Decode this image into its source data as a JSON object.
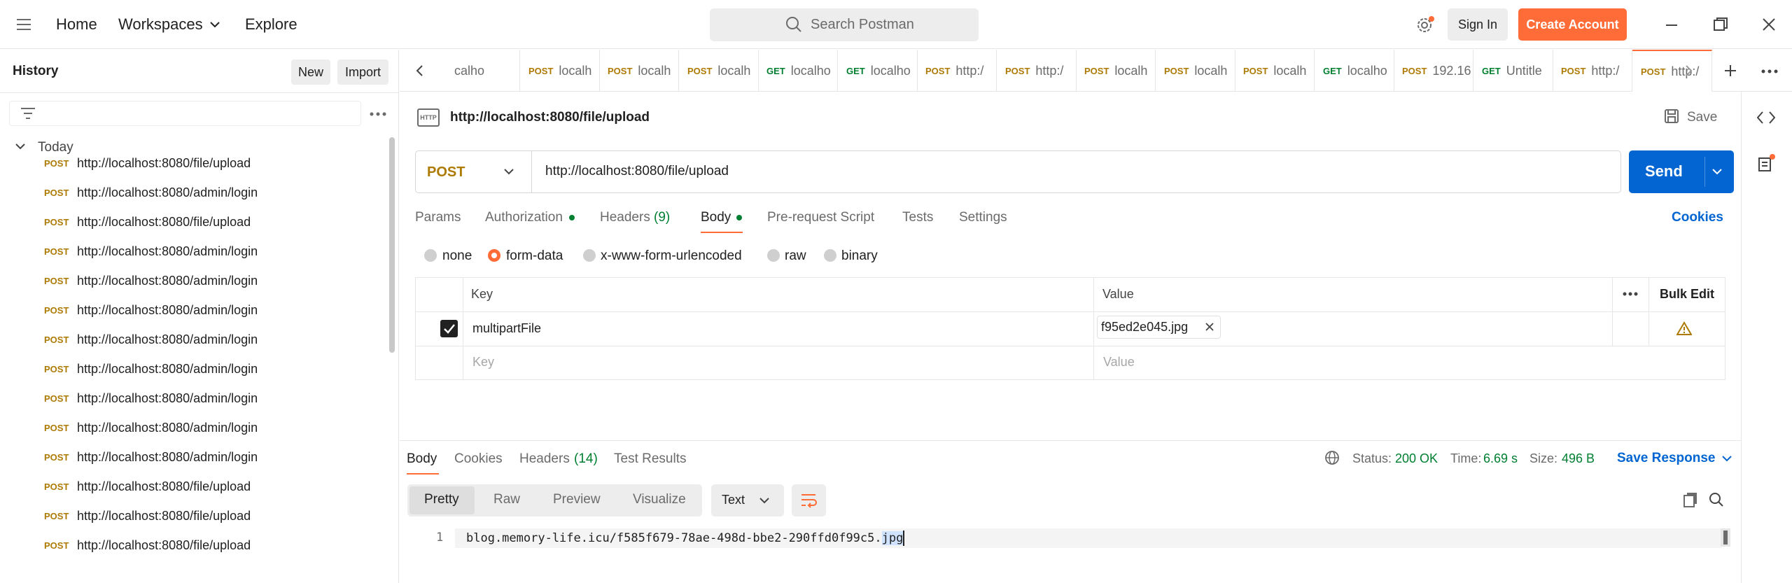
{
  "topbar": {
    "home": "Home",
    "workspaces": "Workspaces",
    "explore": "Explore",
    "search_placeholder": "Search Postman",
    "sign_in": "Sign In",
    "create_account": "Create Account"
  },
  "sidebar": {
    "title": "History",
    "new_button": "New",
    "import_button": "Import",
    "group": "Today",
    "items": [
      {
        "method": "POST",
        "url": "http://localhost:8080/file/upload"
      },
      {
        "method": "POST",
        "url": "http://localhost:8080/admin/login"
      },
      {
        "method": "POST",
        "url": "http://localhost:8080/file/upload"
      },
      {
        "method": "POST",
        "url": "http://localhost:8080/admin/login"
      },
      {
        "method": "POST",
        "url": "http://localhost:8080/admin/login"
      },
      {
        "method": "POST",
        "url": "http://localhost:8080/admin/login"
      },
      {
        "method": "POST",
        "url": "http://localhost:8080/admin/login"
      },
      {
        "method": "POST",
        "url": "http://localhost:8080/admin/login"
      },
      {
        "method": "POST",
        "url": "http://localhost:8080/admin/login"
      },
      {
        "method": "POST",
        "url": "http://localhost:8080/admin/login"
      },
      {
        "method": "POST",
        "url": "http://localhost:8080/admin/login"
      },
      {
        "method": "POST",
        "url": "http://localhost:8080/file/upload"
      },
      {
        "method": "POST",
        "url": "http://localhost:8080/file/upload"
      },
      {
        "method": "POST",
        "url": "http://localhost:8080/file/upload"
      }
    ]
  },
  "tabs": [
    {
      "method": "",
      "name": "calho"
    },
    {
      "method": "POST",
      "name": "localh"
    },
    {
      "method": "POST",
      "name": "localh"
    },
    {
      "method": "POST",
      "name": "localh"
    },
    {
      "method": "GET",
      "name": "localho"
    },
    {
      "method": "GET",
      "name": "localho"
    },
    {
      "method": "POST",
      "name": "http:/"
    },
    {
      "method": "POST",
      "name": "http:/"
    },
    {
      "method": "POST",
      "name": "localh"
    },
    {
      "method": "POST",
      "name": "localh"
    },
    {
      "method": "POST",
      "name": "localh"
    },
    {
      "method": "GET",
      "name": "localho"
    },
    {
      "method": "POST",
      "name": "192.16"
    },
    {
      "method": "GET",
      "name": "Untitle"
    },
    {
      "method": "POST",
      "name": "http:/"
    },
    {
      "method": "POST",
      "name": "http:/"
    }
  ],
  "request": {
    "http_badge": "HTTP",
    "title": "http://localhost:8080/file/upload",
    "save": "Save",
    "method": "POST",
    "url": "http://localhost:8080/file/upload",
    "send": "Send",
    "tabs": {
      "params": "Params",
      "authorization": "Authorization",
      "headers": "Headers",
      "headers_count": "(9)",
      "body": "Body",
      "prerequest": "Pre-request Script",
      "tests": "Tests",
      "settings": "Settings",
      "cookies": "Cookies"
    },
    "body_types": [
      "none",
      "form-data",
      "x-www-form-urlencoded",
      "raw",
      "binary"
    ],
    "table": {
      "key_header": "Key",
      "value_header": "Value",
      "bulk_edit": "Bulk Edit",
      "row_key": "multipartFile",
      "row_value": "f95ed2e045.jpg",
      "key_placeholder": "Key",
      "value_placeholder": "Value"
    }
  },
  "response": {
    "tabs": {
      "body": "Body",
      "cookies": "Cookies",
      "headers": "Headers",
      "headers_count": "(14)",
      "test_results": "Test Results"
    },
    "status_label": "Status:",
    "status_value": "200 OK",
    "time_label": "Time:",
    "time_value": "6.69 s",
    "size_label": "Size:",
    "size_value": "496 B",
    "save_response": "Save Response",
    "views": [
      "Pretty",
      "Raw",
      "Preview",
      "Visualize"
    ],
    "format": "Text",
    "line_number": "1",
    "body_text_main": "blog.memory-life.icu/f585f679-78ae-498d-bbe2-290ffd0f99c5.",
    "body_text_selected": "jpg"
  },
  "colors": {
    "accent": "#ff6c37",
    "send_blue": "#0265d2",
    "post": "#ad7a03",
    "get": "#007f31",
    "status_green": "#007f31"
  }
}
